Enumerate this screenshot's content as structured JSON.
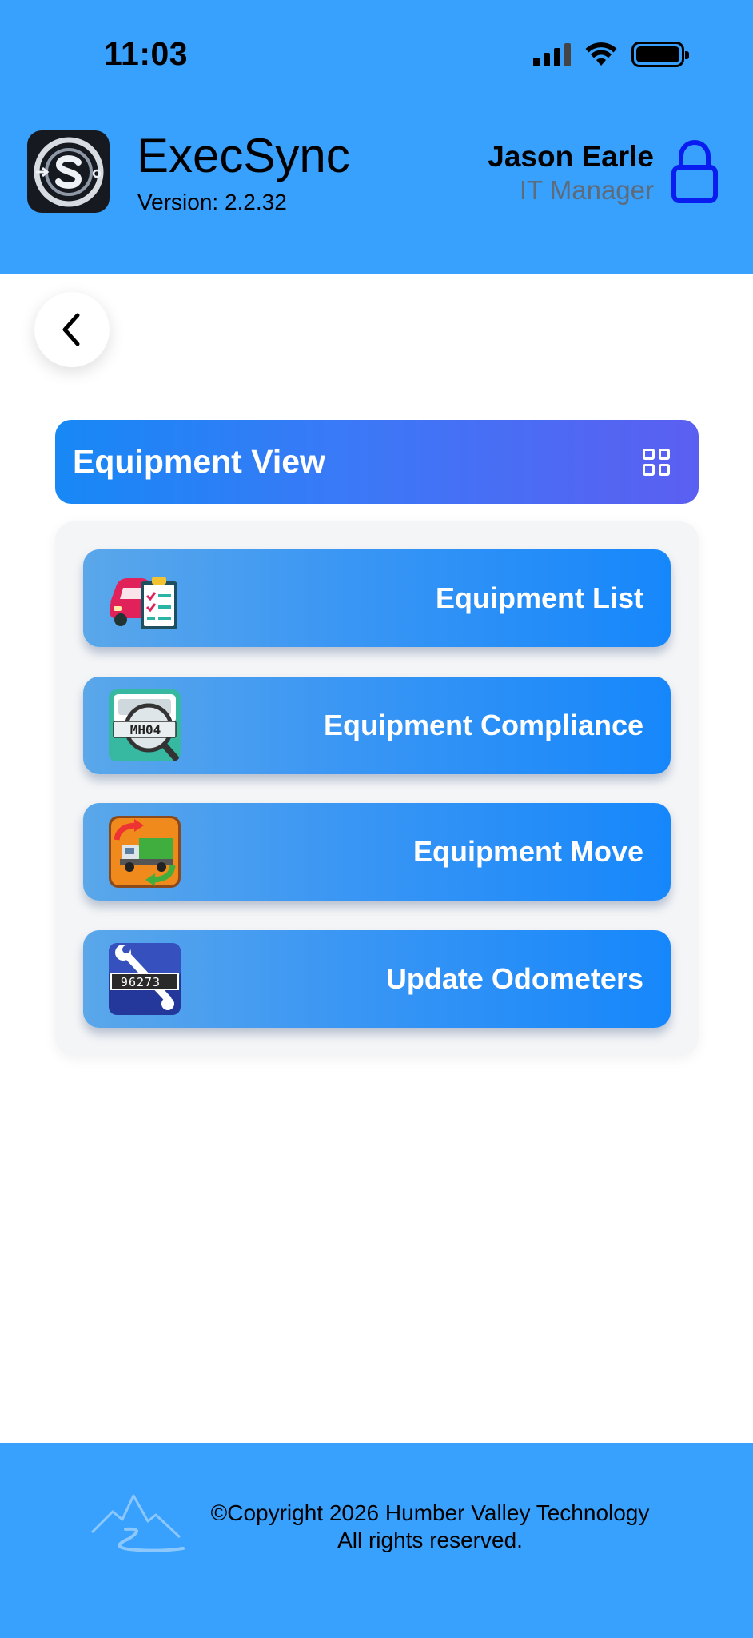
{
  "status_bar": {
    "time": "11:03"
  },
  "header": {
    "app_name": "ExecSync",
    "version": "Version: 2.2.32",
    "user_name": "Jason Earle",
    "user_role": "IT Manager",
    "background_color": "#38a0fd"
  },
  "navigation": {
    "back_icon": "chevron-left-icon"
  },
  "section": {
    "title": "Equipment View",
    "icon": "grid-icon"
  },
  "menu": {
    "items": [
      {
        "label": "Equipment List",
        "icon": "car-checklist-icon"
      },
      {
        "label": "Equipment Compliance",
        "icon": "license-plate-magnifier-icon"
      },
      {
        "label": "Equipment Move",
        "icon": "truck-transfer-icon"
      },
      {
        "label": "Update Odometers",
        "icon": "odometer-wrench-icon",
        "odometer_reading": "96273"
      }
    ]
  },
  "footer": {
    "copyright": "©Copyright 2026 Humber Valley Technology",
    "rights": "All rights reserved."
  },
  "colors": {
    "header": "#38a0fd",
    "lock": "#0a1df0",
    "button_gradient_start": "#5aa7ea",
    "button_gradient_end": "#1687fb"
  }
}
